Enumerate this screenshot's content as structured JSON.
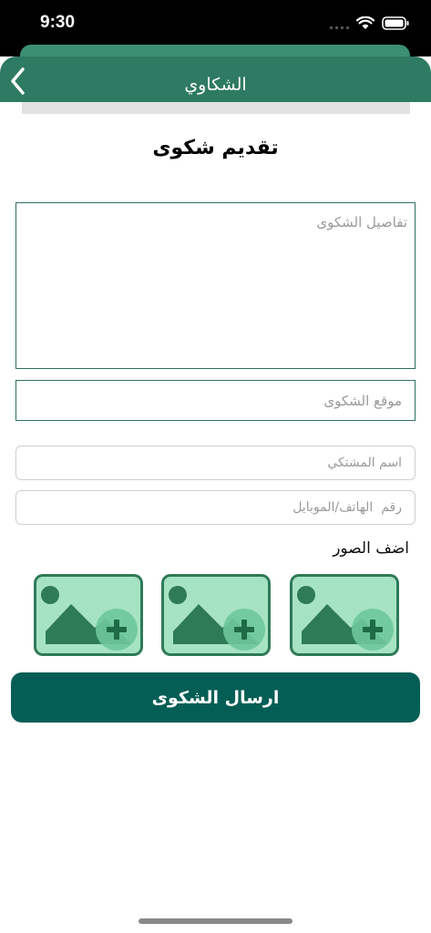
{
  "status_bar": {
    "time": "9:30"
  },
  "header": {
    "title": "الشكاوي"
  },
  "page": {
    "title": "تقديم شكوى"
  },
  "form": {
    "details_placeholder": "تفاصيل الشكوى",
    "location_placeholder": "موقع الشكوى",
    "name_placeholder": "اسم المشتكي",
    "phone_placeholder": "رقم  الهاتف/الموبايل",
    "add_photos_label": "اضف الصور",
    "submit_label": "ارسال الشكوى"
  },
  "icons": {
    "back": "chevron-left-icon",
    "photo_add": "image-add-icon"
  },
  "colors": {
    "header": "#2e7a62",
    "submit": "#055e55",
    "photo_frame": "#2f7a57",
    "photo_fill": "#a6e3c4"
  }
}
